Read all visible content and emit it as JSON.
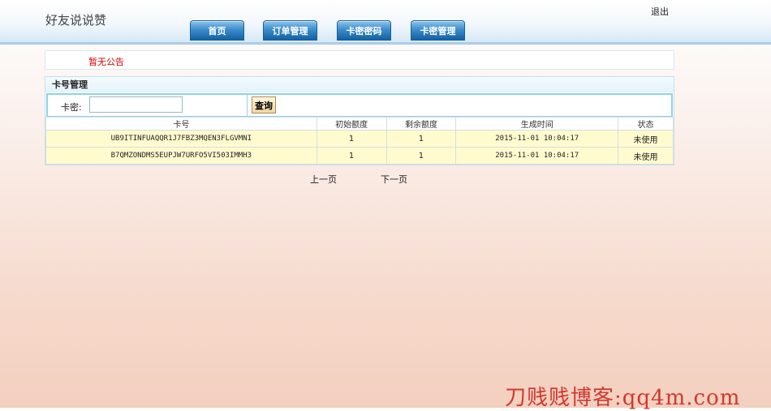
{
  "header": {
    "site_title": "好友说说赞",
    "logout": "退出",
    "nav": [
      {
        "label": "首页"
      },
      {
        "label": "订单管理"
      },
      {
        "label": "卡密密码"
      },
      {
        "label": "卡密管理"
      }
    ]
  },
  "notice": {
    "text": "暂无公告"
  },
  "panel": {
    "title": "卡号管理",
    "search": {
      "label": "卡密:",
      "value": "",
      "button": "查询"
    },
    "table": {
      "headers": [
        "卡号",
        "初始额度",
        "剩余额度",
        "生成时间",
        "状态"
      ],
      "rows": [
        [
          "UB9ITINFUAQQR1J7FBZ3MQEN3FLGVMNI",
          "1",
          "1",
          "2015-11-01 10:04:17",
          "未使用"
        ],
        [
          "B7QMZONDMS5EUPJW7URFO5VI503IMMH3",
          "1",
          "1",
          "2015-11-01 10:04:17",
          "未使用"
        ]
      ]
    }
  },
  "pager": {
    "prev": "上一页",
    "next": "下一页"
  },
  "watermark": "刀贱贱博客:qq4m.com"
}
